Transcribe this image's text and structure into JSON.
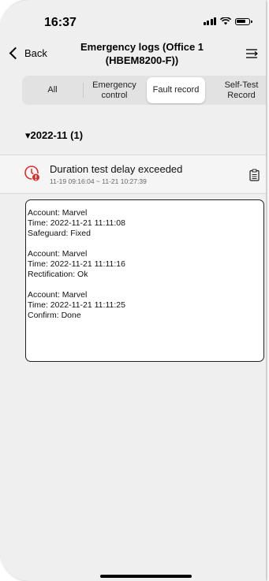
{
  "status_bar": {
    "time": "16:37"
  },
  "nav": {
    "back_label": "Back",
    "title_line1": "Emergency logs (Office 1",
    "title_line2": "(HBEM8200-F))"
  },
  "tabs": [
    {
      "label": "All"
    },
    {
      "label": "Emergency control"
    },
    {
      "label": "Fault record",
      "selected": true
    },
    {
      "label": "Self-Test Record"
    }
  ],
  "group": {
    "label": "▾2022-11  (1)"
  },
  "record": {
    "title": "Duration test delay exceeded",
    "time_range": "11-19 09:16:04 ~ 11-21 10:27:39"
  },
  "details": [
    {
      "account": "Account: Marvel",
      "time": "Time: 2022-11-21 11:11:08",
      "status": "Safeguard: Fixed"
    },
    {
      "account": "Account: Marvel",
      "time": "Time: 2022-11-21 11:11:16",
      "status": "Rectification: Ok"
    },
    {
      "account": "Account: Marvel",
      "time": "Time: 2022-11-21 11:11:25",
      "status": "Confirm: Done"
    }
  ],
  "colors": {
    "alert_red": "#d0312d",
    "background": "#efefef"
  }
}
